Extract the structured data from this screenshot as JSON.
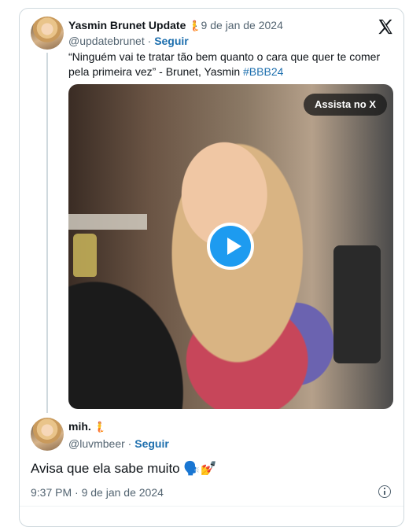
{
  "tweet": {
    "author_name": "Yasmin Brunet Update",
    "author_emoji": "🧜",
    "date": "· 9 de jan de 2024",
    "handle": "@updatebrunet",
    "follow_sep": " · ",
    "follow_label": "Seguir",
    "text": "“Ninguém vai te tratar tão bem quanto o cara que quer te comer pela primeira vez” - Brunet, Yasmin ",
    "hashtag": "#BBB24",
    "video_cta": "Assista no X"
  },
  "reply": {
    "author_name": "mih.",
    "author_emoji": "🧜",
    "handle": "@luvmbeer",
    "follow_sep": " · ",
    "follow_label": "Seguir",
    "text": "Avisa que ela sabe muito 🗣️💅",
    "timestamp": "9:37 PM · 9 de jan de 2024"
  },
  "colors": {
    "link": "#1d6fae",
    "play": "#1d9bf0",
    "border": "#cfd9de"
  },
  "icons": [
    "x-logo-icon",
    "play-icon",
    "info-icon"
  ]
}
